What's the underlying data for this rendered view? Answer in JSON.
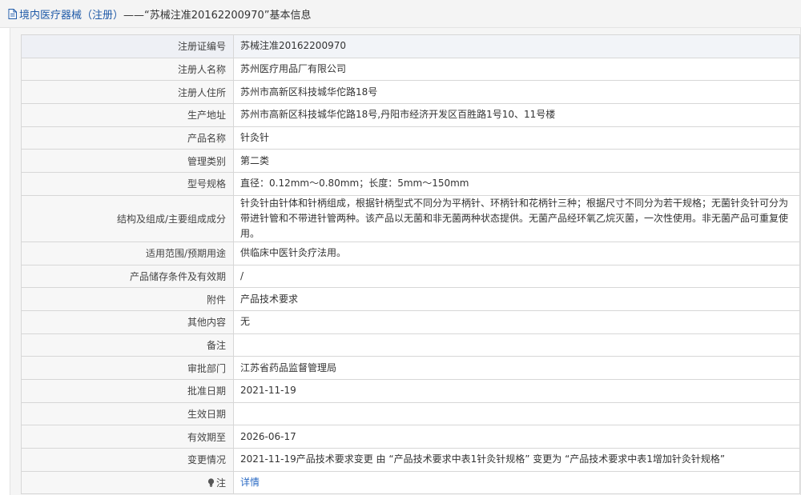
{
  "page": {
    "title_link": "境内医疗器械（注册）",
    "title_rest": "——“苏械注准20162200970”基本信息"
  },
  "rows": [
    {
      "label": "注册证编号",
      "value": "苏械注准20162200970"
    },
    {
      "label": "注册人名称",
      "value": "苏州医疗用品厂有限公司"
    },
    {
      "label": "注册人住所",
      "value": "苏州市高新区科技城华佗路18号"
    },
    {
      "label": "生产地址",
      "value": "苏州市高新区科技城华佗路18号,丹阳市经济开发区百胜路1号10、11号楼"
    },
    {
      "label": "产品名称",
      "value": "针灸针"
    },
    {
      "label": "管理类别",
      "value": "第二类"
    },
    {
      "label": "型号规格",
      "value": "直径：0.12mm～0.80mm；长度：5mm～150mm"
    },
    {
      "label": "结构及组成/主要组成成分",
      "value": "针灸针由针体和针柄组成，根据针柄型式不同分为平柄针、环柄针和花柄针三种；根据尺寸不同分为若干规格；无菌针灸针可分为带进针管和不带进针管两种。该产品以无菌和非无菌两种状态提供。无菌产品经环氧乙烷灭菌，一次性使用。非无菌产品可重复使用。"
    },
    {
      "label": "适用范围/预期用途",
      "value": "供临床中医针灸疗法用。"
    },
    {
      "label": "产品储存条件及有效期",
      "value": "/"
    },
    {
      "label": "附件",
      "value": "产品技术要求"
    },
    {
      "label": "其他内容",
      "value": "无"
    },
    {
      "label": "备注",
      "value": ""
    },
    {
      "label": "审批部门",
      "value": "江苏省药品监督管理局"
    },
    {
      "label": "批准日期",
      "value": "2021-11-19"
    },
    {
      "label": "生效日期",
      "value": ""
    },
    {
      "label": "有效期至",
      "value": "2026-06-17"
    },
    {
      "label": "变更情况",
      "value": "2021-11-19产品技术要求变更 由 “产品技术要求中表1针灸针规格” 变更为 “产品技术要求中表1增加针灸针规格”"
    }
  ],
  "note": {
    "label": "注",
    "link_text": "详情"
  }
}
